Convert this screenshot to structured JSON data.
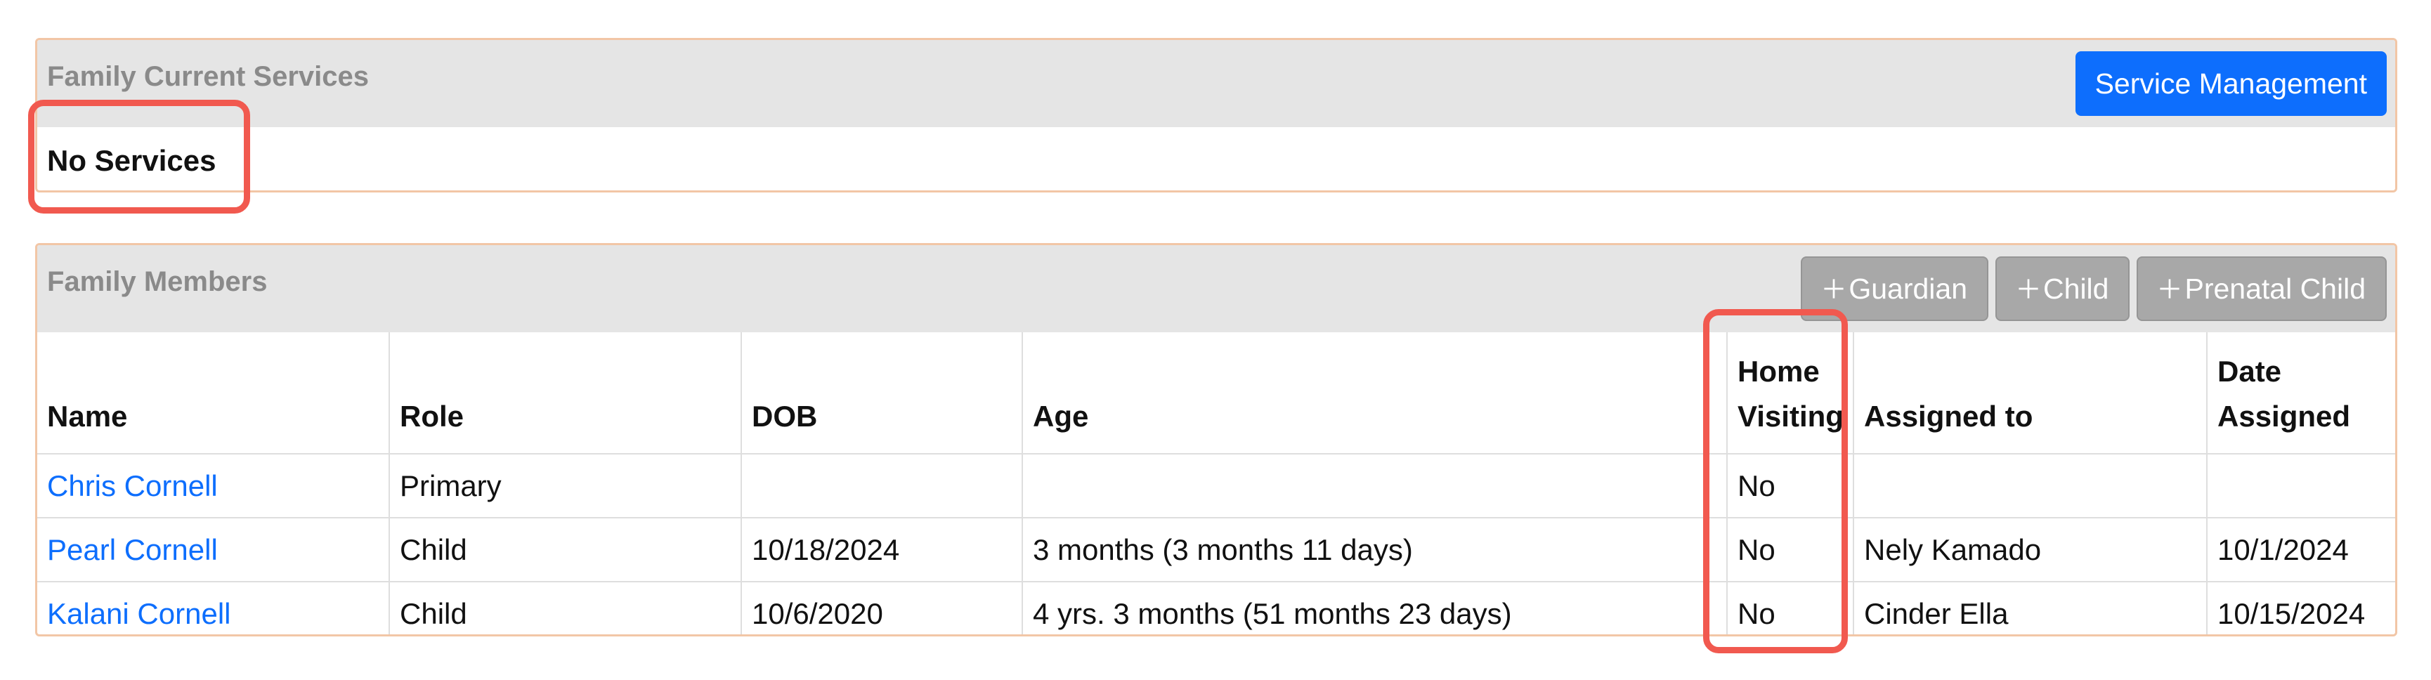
{
  "services_panel": {
    "title": "Family Current Services",
    "button_label": "Service Management",
    "empty_text": "No Services"
  },
  "members_panel": {
    "title": "Family Members",
    "buttons": {
      "guardian": "Guardian",
      "child": "Child",
      "prenatal_child": "Prenatal Child"
    },
    "columns": {
      "name": "Name",
      "role": "Role",
      "dob": "DOB",
      "age": "Age",
      "home_visiting_line1": "Home",
      "home_visiting_line2": "Visiting",
      "assigned_to": "Assigned to",
      "date_assigned_line1": "Date",
      "date_assigned_line2": "Assigned"
    },
    "rows": [
      {
        "name": "Chris Cornell",
        "role": "Primary",
        "dob": "",
        "age": "",
        "home_visiting": "No",
        "assigned_to": "",
        "date_assigned": ""
      },
      {
        "name": "Pearl Cornell",
        "role": "Child",
        "dob": "10/18/2024",
        "age": "3 months (3 months 11 days)",
        "home_visiting": "No",
        "assigned_to": "Nely Kamado",
        "date_assigned": "10/1/2024"
      },
      {
        "name": "Kalani Cornell",
        "role": "Child",
        "dob": "10/6/2020",
        "age": "4 yrs. 3 months (51 months 23 days)",
        "home_visiting": "No",
        "assigned_to": "Cinder Ella",
        "date_assigned": "10/15/2024"
      }
    ]
  },
  "colors": {
    "primary_button": "#0d6efd",
    "link": "#0d6efd",
    "highlight": "#f1594f",
    "panel_border": "#f2c6a6",
    "header_bg": "#e5e5e5"
  },
  "icons": {
    "add": "plus-icon"
  }
}
